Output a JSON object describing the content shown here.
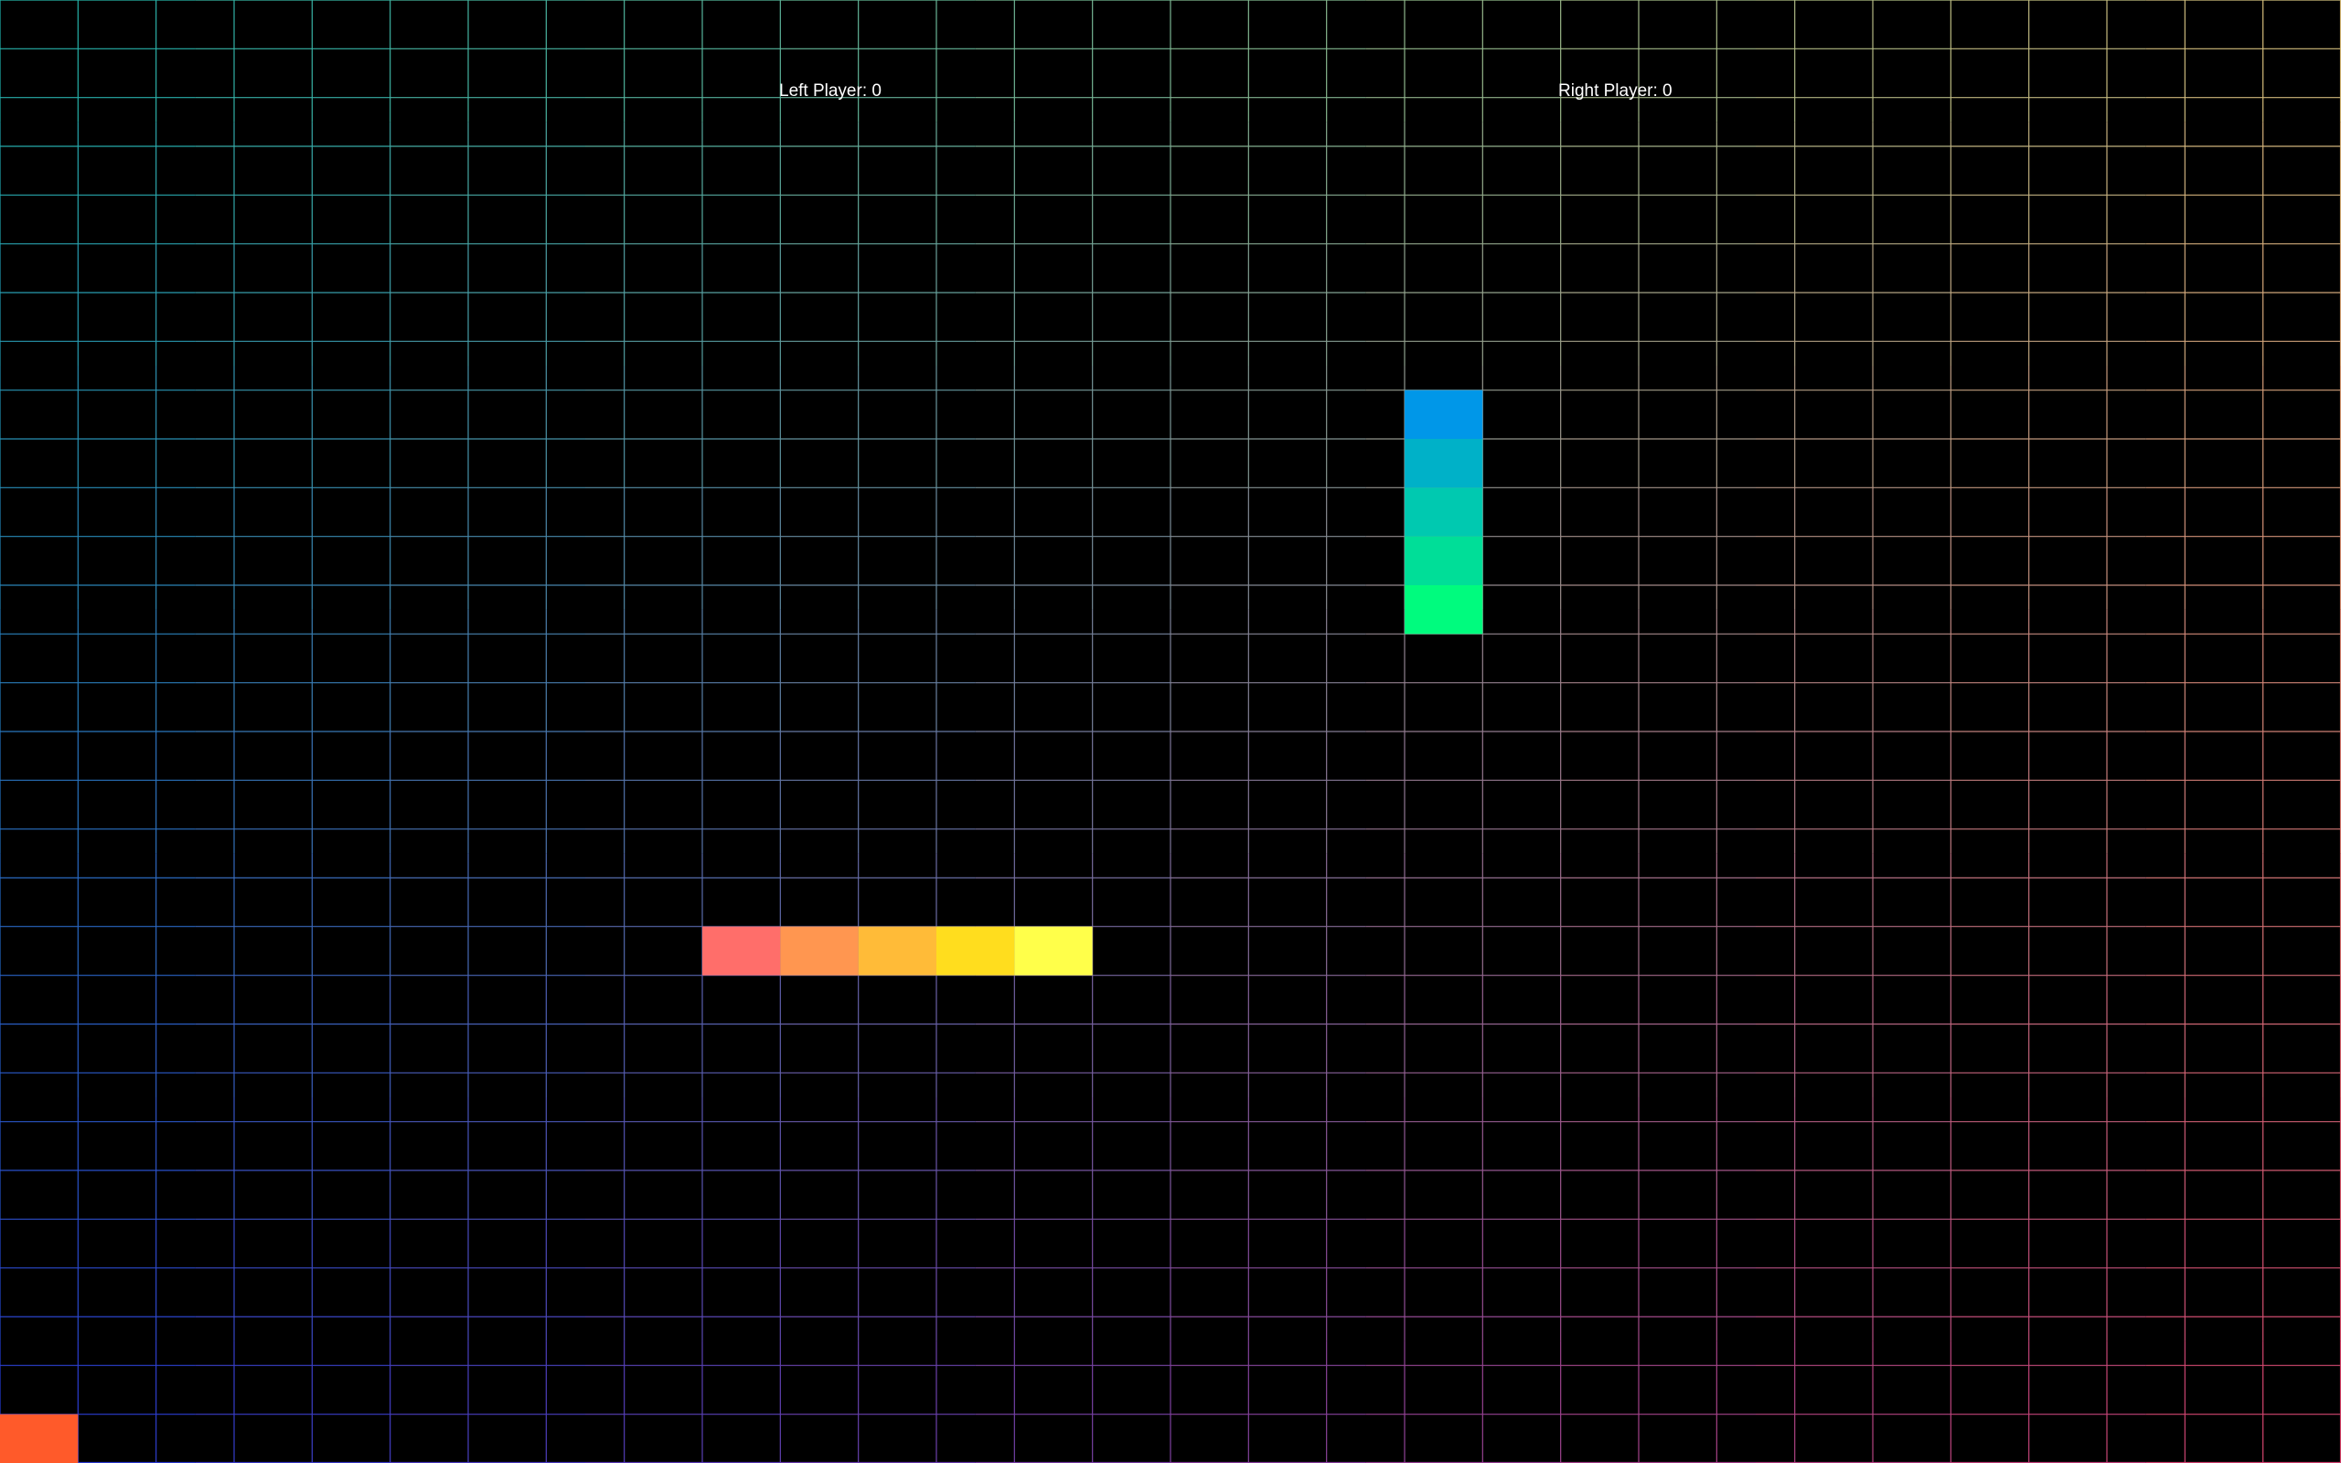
{
  "scoreboard": {
    "left_label": "Left Player: 0",
    "right_label": "Right Player: 0"
  },
  "board": {
    "columns": 30,
    "rows": 30,
    "background": "#000000",
    "grid_gradient": {
      "top_left": "#1fb5a8",
      "top_right": "#d8c07a",
      "bottom_left": "#2438d6",
      "bottom_right": "#d8406a"
    }
  },
  "snakes": [
    {
      "name": "left-player-snake",
      "cells": [
        [
          9,
          19
        ],
        [
          10,
          19
        ],
        [
          11,
          19
        ],
        [
          12,
          19
        ],
        [
          13,
          19
        ]
      ],
      "colors": [
        "#ff6e6a",
        "#ff9650",
        "#ffbb38",
        "#ffdd1e",
        "#ffff4a"
      ]
    },
    {
      "name": "right-player-snake",
      "cells": [
        [
          18,
          8
        ],
        [
          18,
          9
        ],
        [
          18,
          10
        ],
        [
          18,
          11
        ],
        [
          18,
          12
        ]
      ],
      "colors": [
        "#0097e8",
        "#00b1c8",
        "#00c9b0",
        "#00de98",
        "#00fb7e"
      ]
    }
  ],
  "food": {
    "cell": [
      0,
      29
    ],
    "color": "#ff5a2a"
  }
}
